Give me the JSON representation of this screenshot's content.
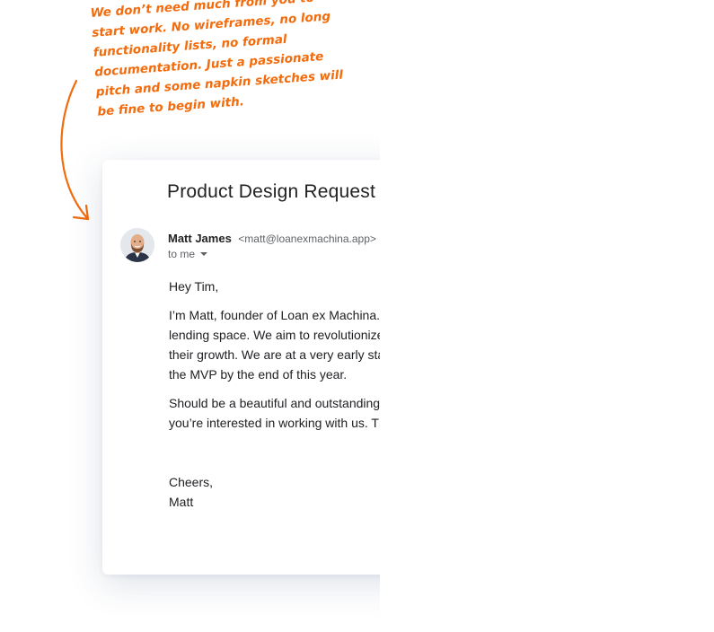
{
  "annotation": {
    "lines": [
      "We don’t need much from you to",
      "start work. No wireframes, no long",
      "functionality lists, no formal",
      "documentation. Just a passionate",
      "pitch and some napkin sketches will",
      "be fine to begin with."
    ],
    "color": "#f26c0d"
  },
  "email": {
    "subject": "Product Design Request",
    "sender": {
      "name": "Matt James",
      "email": "<matt@loanexmachina.app>",
      "to_label": "to me",
      "avatar_icon": "avatar-photo-icon"
    },
    "greeting": "Hey Tim,",
    "paragraph1": [
      "I’m Matt, founder of Loan ex Machina.",
      "lending space. We aim to revolutionize",
      "their growth. We are at a very early stag",
      "the MVP by the end of this year."
    ],
    "paragraph2": [
      "Should be a beautiful and outstanding",
      "you’re interested in working with us. Th"
    ],
    "signoff": "Cheers,",
    "signature": "Matt"
  }
}
